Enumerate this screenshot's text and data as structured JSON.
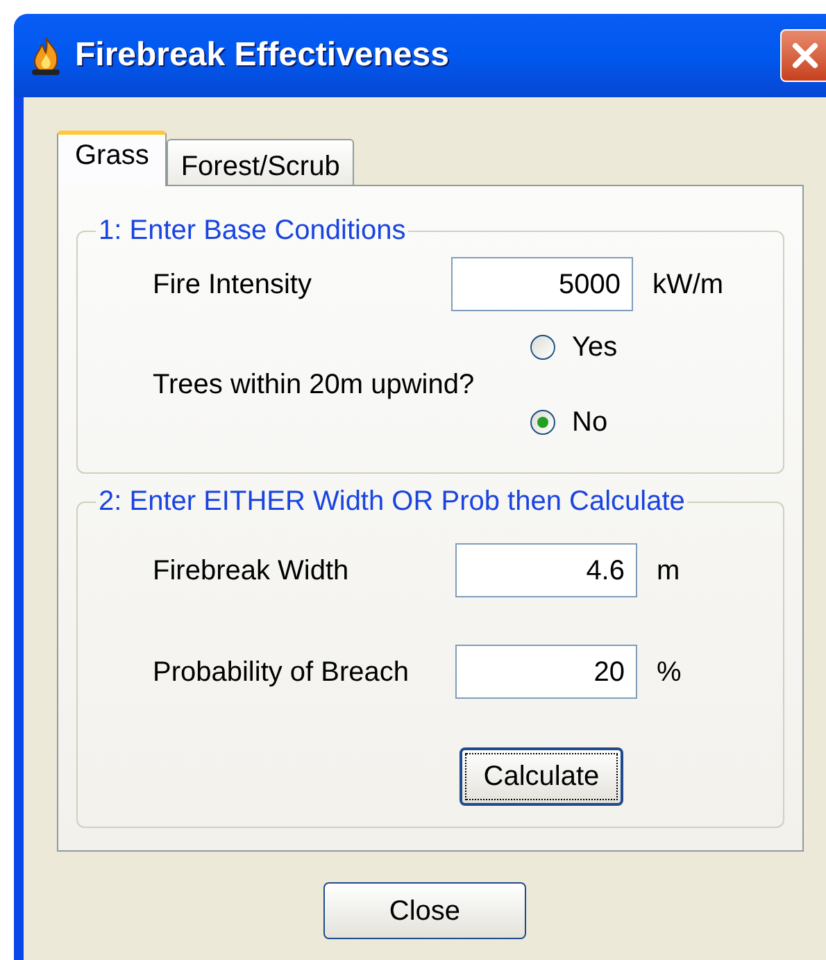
{
  "window": {
    "title": "Firebreak Effectiveness"
  },
  "tabs": [
    {
      "label": "Grass",
      "selected": true
    },
    {
      "label": "Forest/Scrub",
      "selected": false
    }
  ],
  "base_conditions": {
    "title": "1: Enter Base Conditions",
    "fire_intensity": {
      "label": "Fire Intensity",
      "value": "5000",
      "unit": "kW/m"
    },
    "trees": {
      "label": "Trees within 20m upwind?",
      "options": [
        {
          "label": "Yes",
          "selected": false
        },
        {
          "label": "No",
          "selected": true
        }
      ]
    }
  },
  "calculation": {
    "title": "2: Enter EITHER Width OR Prob then Calculate",
    "fields": [
      {
        "label": "Firebreak Width",
        "value": "4.6",
        "unit": "m"
      },
      {
        "label": "Probability of Breach",
        "value": "20",
        "unit": "%"
      }
    ],
    "calculate_button": "Calculate"
  },
  "close_button": "Close"
}
